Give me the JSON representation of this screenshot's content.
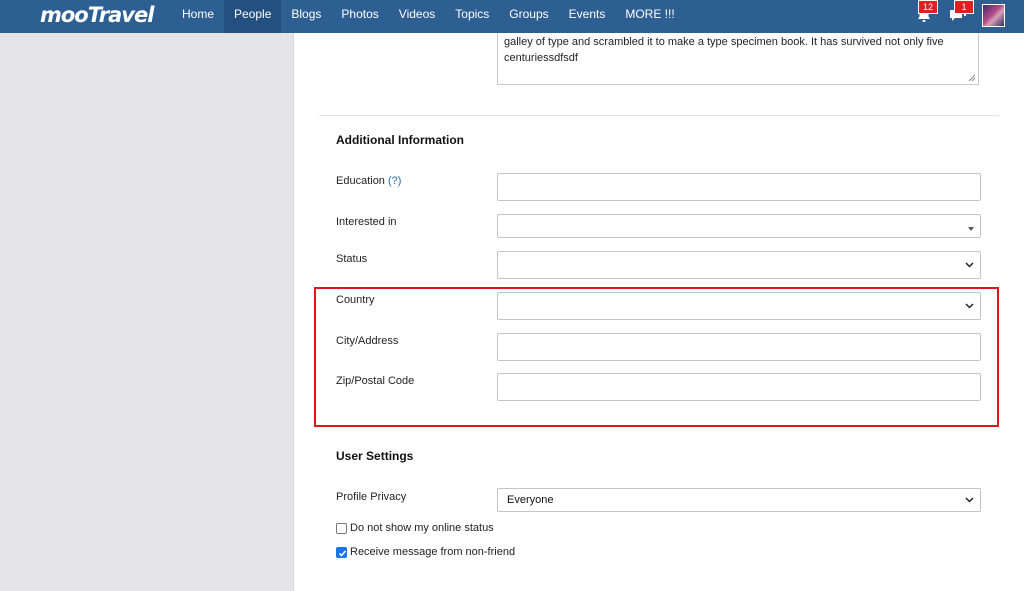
{
  "nav": {
    "logo": "mooTravel",
    "items": [
      {
        "label": "Home",
        "active": false
      },
      {
        "label": "People",
        "active": true
      },
      {
        "label": "Blogs",
        "active": false
      },
      {
        "label": "Photos",
        "active": false
      },
      {
        "label": "Videos",
        "active": false
      },
      {
        "label": "Topics",
        "active": false
      },
      {
        "label": "Groups",
        "active": false
      },
      {
        "label": "Events",
        "active": false
      },
      {
        "label": "MORE !!!",
        "active": false
      }
    ],
    "notifications_count": "12",
    "messages_count": "1",
    "icons": {
      "notifications": "bell-icon",
      "messages": "chat-icon",
      "avatar": "user-avatar"
    }
  },
  "about": {
    "text": "galley of type and scrambled it to make a type specimen book. It has survived not only five centuriessdfsdf"
  },
  "additional": {
    "title": "Additional Information",
    "education_label": "Education",
    "education_help": "(?)",
    "education_value": "",
    "interested_label": "Interested in",
    "interested_value": "",
    "status_label": "Status",
    "status_value": "",
    "country_label": "Country",
    "country_value": "",
    "city_label": "City/Address",
    "city_value": "",
    "zip_label": "Zip/Postal Code",
    "zip_value": ""
  },
  "settings": {
    "title": "User Settings",
    "privacy_label": "Profile Privacy",
    "privacy_value": "Everyone",
    "online_status_label": "Do not show my online status",
    "online_status_checked": false,
    "receive_message_label": "Receive message from non-friend",
    "receive_message_checked": true
  },
  "colors": {
    "navbar": "#2d5f93",
    "highlight": "#e0141e",
    "checkbox": "#1a73e8"
  }
}
